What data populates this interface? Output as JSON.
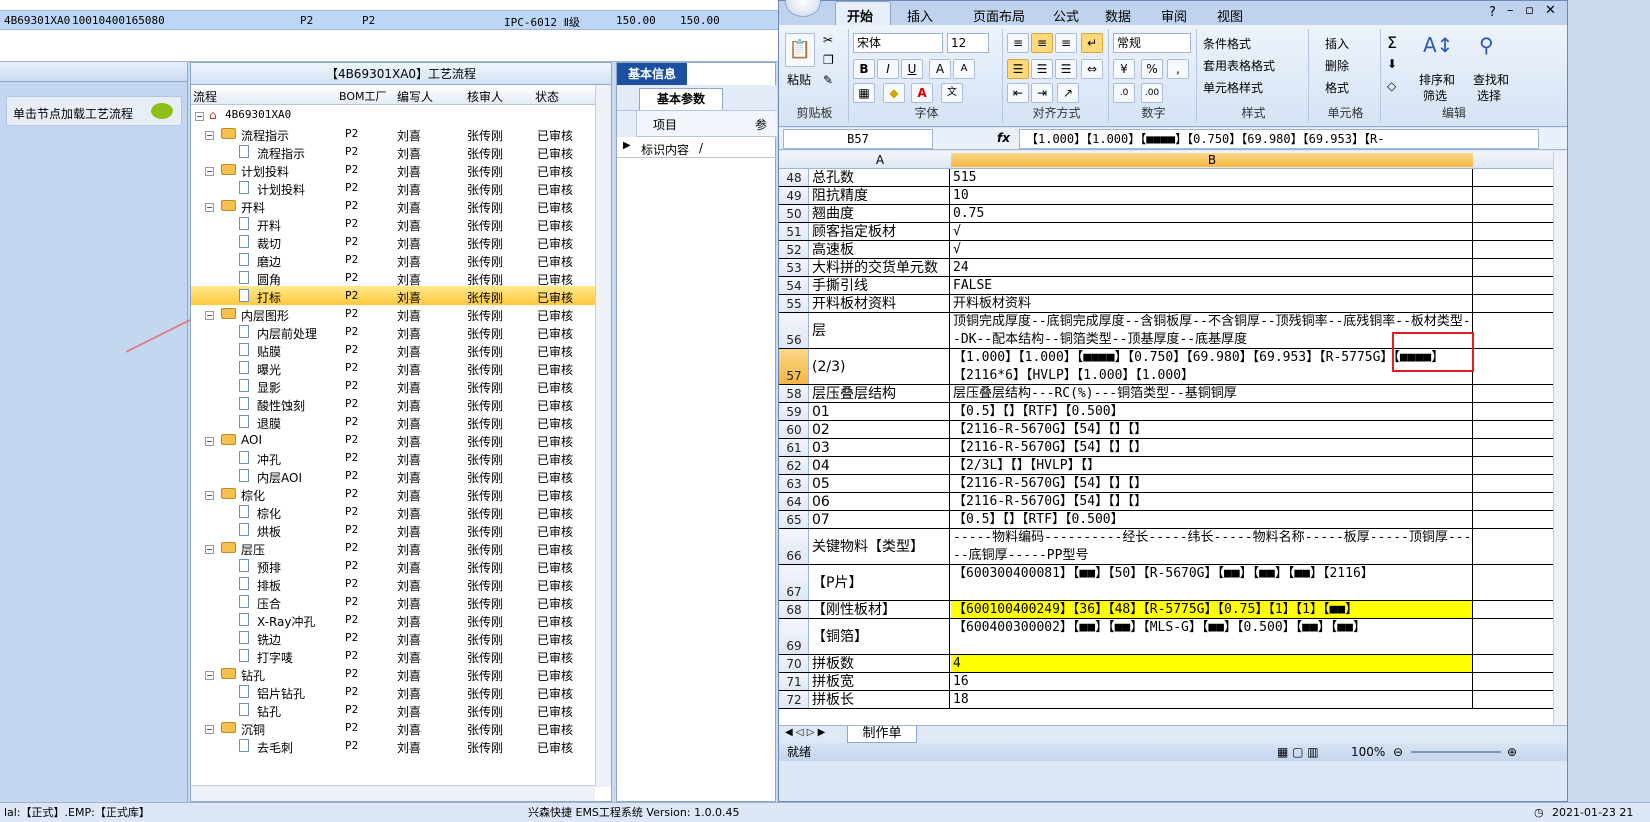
{
  "top_row": {
    "c1": "4B69301XA0",
    "c2": "10010400165080",
    "c3": "P2",
    "c4": "P2",
    "c5": "IPC-6012 Ⅱ级",
    "c6": "150.00",
    "c7": "150.00"
  },
  "left_hint": "单击节点加载工艺流程",
  "process": {
    "title": "【4B69301XA0】工艺流程",
    "columns": [
      "流程",
      "BOM工厂",
      "编写人",
      "核审人",
      "状态"
    ],
    "root": "4B69301XA0",
    "rows": [
      {
        "name": "流程指示",
        "type": "folder",
        "bom": "P2",
        "writer": "刘喜",
        "reviewer": "张传刚",
        "status": "已审核"
      },
      {
        "name": "流程指示",
        "type": "doc",
        "bom": "P2",
        "writer": "刘喜",
        "reviewer": "张传刚",
        "status": "已审核"
      },
      {
        "name": "计划投料",
        "type": "folder",
        "bom": "P2",
        "writer": "刘喜",
        "reviewer": "张传刚",
        "status": "已审核"
      },
      {
        "name": "计划投料",
        "type": "doc",
        "bom": "P2",
        "writer": "刘喜",
        "reviewer": "张传刚",
        "status": "已审核"
      },
      {
        "name": "开料",
        "type": "folder",
        "bom": "P2",
        "writer": "刘喜",
        "reviewer": "张传刚",
        "status": "已审核"
      },
      {
        "name": "开料",
        "type": "doc",
        "bom": "P2",
        "writer": "刘喜",
        "reviewer": "张传刚",
        "status": "已审核"
      },
      {
        "name": "裁切",
        "type": "doc",
        "bom": "P2",
        "writer": "刘喜",
        "reviewer": "张传刚",
        "status": "已审核"
      },
      {
        "name": "磨边",
        "type": "doc",
        "bom": "P2",
        "writer": "刘喜",
        "reviewer": "张传刚",
        "status": "已审核"
      },
      {
        "name": "圆角",
        "type": "doc",
        "bom": "P2",
        "writer": "刘喜",
        "reviewer": "张传刚",
        "status": "已审核"
      },
      {
        "name": "打标",
        "type": "doc",
        "bom": "P2",
        "writer": "刘喜",
        "reviewer": "张传刚",
        "status": "已审核",
        "selected": true
      },
      {
        "name": "内层图形",
        "type": "folder",
        "bom": "P2",
        "writer": "刘喜",
        "reviewer": "张传刚",
        "status": "已审核"
      },
      {
        "name": "内层前处理",
        "type": "doc",
        "bom": "P2",
        "writer": "刘喜",
        "reviewer": "张传刚",
        "status": "已审核"
      },
      {
        "name": "贴膜",
        "type": "doc",
        "bom": "P2",
        "writer": "刘喜",
        "reviewer": "张传刚",
        "status": "已审核"
      },
      {
        "name": "曝光",
        "type": "doc",
        "bom": "P2",
        "writer": "刘喜",
        "reviewer": "张传刚",
        "status": "已审核"
      },
      {
        "name": "显影",
        "type": "doc",
        "bom": "P2",
        "writer": "刘喜",
        "reviewer": "张传刚",
        "status": "已审核"
      },
      {
        "name": "酸性蚀刻",
        "type": "doc",
        "bom": "P2",
        "writer": "刘喜",
        "reviewer": "张传刚",
        "status": "已审核"
      },
      {
        "name": "退膜",
        "type": "doc",
        "bom": "P2",
        "writer": "刘喜",
        "reviewer": "张传刚",
        "status": "已审核"
      },
      {
        "name": "AOI",
        "type": "folder",
        "bom": "P2",
        "writer": "刘喜",
        "reviewer": "张传刚",
        "status": "已审核"
      },
      {
        "name": "冲孔",
        "type": "doc",
        "bom": "P2",
        "writer": "刘喜",
        "reviewer": "张传刚",
        "status": "已审核"
      },
      {
        "name": "内层AOI",
        "type": "doc",
        "bom": "P2",
        "writer": "刘喜",
        "reviewer": "张传刚",
        "status": "已审核"
      },
      {
        "name": "棕化",
        "type": "folder",
        "bom": "P2",
        "writer": "刘喜",
        "reviewer": "张传刚",
        "status": "已审核"
      },
      {
        "name": "棕化",
        "type": "doc",
        "bom": "P2",
        "writer": "刘喜",
        "reviewer": "张传刚",
        "status": "已审核"
      },
      {
        "name": "烘板",
        "type": "doc",
        "bom": "P2",
        "writer": "刘喜",
        "reviewer": "张传刚",
        "status": "已审核"
      },
      {
        "name": "层压",
        "type": "folder",
        "bom": "P2",
        "writer": "刘喜",
        "reviewer": "张传刚",
        "status": "已审核"
      },
      {
        "name": "预排",
        "type": "doc",
        "bom": "P2",
        "writer": "刘喜",
        "reviewer": "张传刚",
        "status": "已审核"
      },
      {
        "name": "排板",
        "type": "doc",
        "bom": "P2",
        "writer": "刘喜",
        "reviewer": "张传刚",
        "status": "已审核"
      },
      {
        "name": "压合",
        "type": "doc",
        "bom": "P2",
        "writer": "刘喜",
        "reviewer": "张传刚",
        "status": "已审核"
      },
      {
        "name": "X-Ray冲孔",
        "type": "doc",
        "bom": "P2",
        "writer": "刘喜",
        "reviewer": "张传刚",
        "status": "已审核"
      },
      {
        "name": "铣边",
        "type": "doc",
        "bom": "P2",
        "writer": "刘喜",
        "reviewer": "张传刚",
        "status": "已审核"
      },
      {
        "name": "打字唛",
        "type": "doc",
        "bom": "P2",
        "writer": "刘喜",
        "reviewer": "张传刚",
        "status": "已审核"
      },
      {
        "name": "钻孔",
        "type": "folder",
        "bom": "P2",
        "writer": "刘喜",
        "reviewer": "张传刚",
        "status": "已审核"
      },
      {
        "name": "铝片钻孔",
        "type": "doc",
        "bom": "P2",
        "writer": "刘喜",
        "reviewer": "张传刚",
        "status": "已审核"
      },
      {
        "name": "钻孔",
        "type": "doc",
        "bom": "P2",
        "writer": "刘喜",
        "reviewer": "张传刚",
        "status": "已审核"
      },
      {
        "name": "沉铜",
        "type": "folder",
        "bom": "P2",
        "writer": "刘喜",
        "reviewer": "张传刚",
        "status": "已审核"
      },
      {
        "name": "去毛刺",
        "type": "doc",
        "bom": "P2",
        "writer": "刘喜",
        "reviewer": "张传刚",
        "status": "已审核"
      }
    ]
  },
  "info": {
    "tab": "基本信息",
    "subtab": "基本参数",
    "col_item": "项目",
    "col_param": "参",
    "row_label": "标识内容",
    "row_value": "/"
  },
  "excel": {
    "tabs": [
      "开始",
      "插入",
      "页面布局",
      "公式",
      "数据",
      "审阅",
      "视图"
    ],
    "font": "宋体",
    "size": "12",
    "number_format": "常规",
    "groups": {
      "clipboard": "剪贴板",
      "font": "字体",
      "align": "对齐方式",
      "number": "数字",
      "style": "样式",
      "cells": "单元格",
      "edit": "编辑"
    },
    "buttons": {
      "paste": "粘贴",
      "cond": "条件格式",
      "table": "套用表格格式",
      "cellstyle": "单元格样式",
      "insert": "插入",
      "delete": "删除",
      "format": "格式",
      "sort": "排序和",
      "sort2": "筛选",
      "find": "查找和",
      "find2": "选择"
    },
    "namebox": "B57",
    "formula": "【1.000】【1.000】【■■■■】【0.750】【69.980】【69.953】【R-",
    "col_a": "A",
    "col_b": "B",
    "rows": [
      {
        "n": "48",
        "a": "总孔数",
        "b": "515"
      },
      {
        "n": "49",
        "a": "阻抗精度",
        "b": "10"
      },
      {
        "n": "50",
        "a": "翘曲度",
        "b": "0.75"
      },
      {
        "n": "51",
        "a": "顾客指定板材",
        "b": "√"
      },
      {
        "n": "52",
        "a": "高速板",
        "b": "√"
      },
      {
        "n": "53",
        "a": "大料拼的交货单元数",
        "b": "24"
      },
      {
        "n": "54",
        "a": "手撕引线",
        "b": "FALSE"
      },
      {
        "n": "55",
        "a": "开料板材资料",
        "b": "开料板材资料"
      },
      {
        "n": "56",
        "a": "层",
        "b": "顶铜完成厚度--底铜完成厚度--含铜板厚--不含铜厚--顶残铜率--底残铜率--板材类型--DK--配本结构--铜箔类型--顶基厚度--底基厚度",
        "tall": true
      },
      {
        "n": "57",
        "a": "(2/3)",
        "b": "【1.000】【1.000】【■■■■】【0.750】【69.980】【69.953】【R-5775G】【■■■■】【2116*6】【HVLP】【1.000】【1.000】",
        "tall": true,
        "sel": true
      },
      {
        "n": "58",
        "a": "层压叠层结构",
        "b": "层压叠层结构---RC(%)---铜箔类型--基铜铜厚"
      },
      {
        "n": "59",
        "a": "01",
        "b": "【0.5】【】【RTF】【0.500】"
      },
      {
        "n": "60",
        "a": "02",
        "b": "【2116-R-5670G】【54】【】【】"
      },
      {
        "n": "61",
        "a": "03",
        "b": "【2116-R-5670G】【54】【】【】"
      },
      {
        "n": "62",
        "a": "04",
        "b": "【2/3L】【】【HVLP】【】"
      },
      {
        "n": "63",
        "a": "05",
        "b": "【2116-R-5670G】【54】【】【】"
      },
      {
        "n": "64",
        "a": "06",
        "b": "【2116-R-5670G】【54】【】【】"
      },
      {
        "n": "65",
        "a": "07",
        "b": "【0.5】【】【RTF】【0.500】"
      },
      {
        "n": "66",
        "a": "关键物料【类型】",
        "b": "-----物料编码----------经长-----纬长-----物料名称-----板厚-----顶铜厚-----底铜厚-----PP型号",
        "tall": true
      },
      {
        "n": "67",
        "a": "【P片】",
        "b": "【600300400081】【■■】【50】【R-5670G】【■■】【■■】【■■】【2116】",
        "tall": true
      },
      {
        "n": "68",
        "a": "【刚性板材】",
        "b": "【600100400249】【36】【48】【R-5775G】【0.75】【1】【1】【■■】",
        "yellow": true
      },
      {
        "n": "69",
        "a": "【铜箔】",
        "b": "【600400300002】【■■】【■■】【MLS-G】【■■】【0.500】【■■】【■■】",
        "tall": true
      },
      {
        "n": "70",
        "a": "拼板数",
        "b": "4",
        "yellow": true
      },
      {
        "n": "71",
        "a": "拼板宽",
        "b": "16"
      },
      {
        "n": "72",
        "a": "拼板长",
        "b": "18"
      }
    ],
    "sheet_tab": "制作单",
    "status_ready": "就绪",
    "zoom": "100%"
  },
  "bottom": {
    "left": "lal:【正式】.EMP:【正式库】",
    "center": "兴森快捷 EMS工程系统 Version: 1.0.0.45",
    "right": "2021-01-23 21"
  }
}
